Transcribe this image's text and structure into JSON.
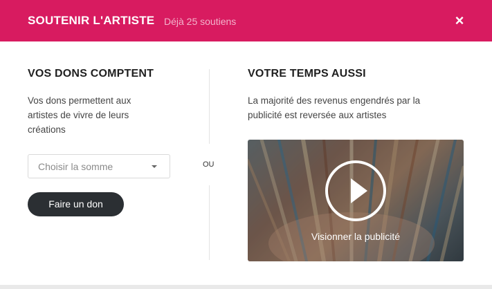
{
  "header": {
    "title": "SOUTENIR L'ARTISTE",
    "subtitle": "Déjà 25 soutiens",
    "close_label": "×"
  },
  "donations": {
    "title": "VOS DONS COMPTENT",
    "text_lines": [
      "Vos dons permettent aux",
      "artistes de vivre de leurs",
      "créations"
    ],
    "select_placeholder": "Choisir la somme",
    "button_label": "Faire un don"
  },
  "separator": {
    "label": "OU"
  },
  "time": {
    "title": "VOTRE TEMPS AUSSI",
    "text_lines": [
      "La majorité des revenus engendrés par la",
      "publicité est reversée aux artistes"
    ],
    "video_label": "Visionner la publicité"
  },
  "colors": {
    "header_bg": "#d81b60",
    "button_bg": "#2b2f33"
  },
  "icons": {
    "close": "close-icon",
    "caret": "chevron-down-icon",
    "play": "play-icon"
  }
}
